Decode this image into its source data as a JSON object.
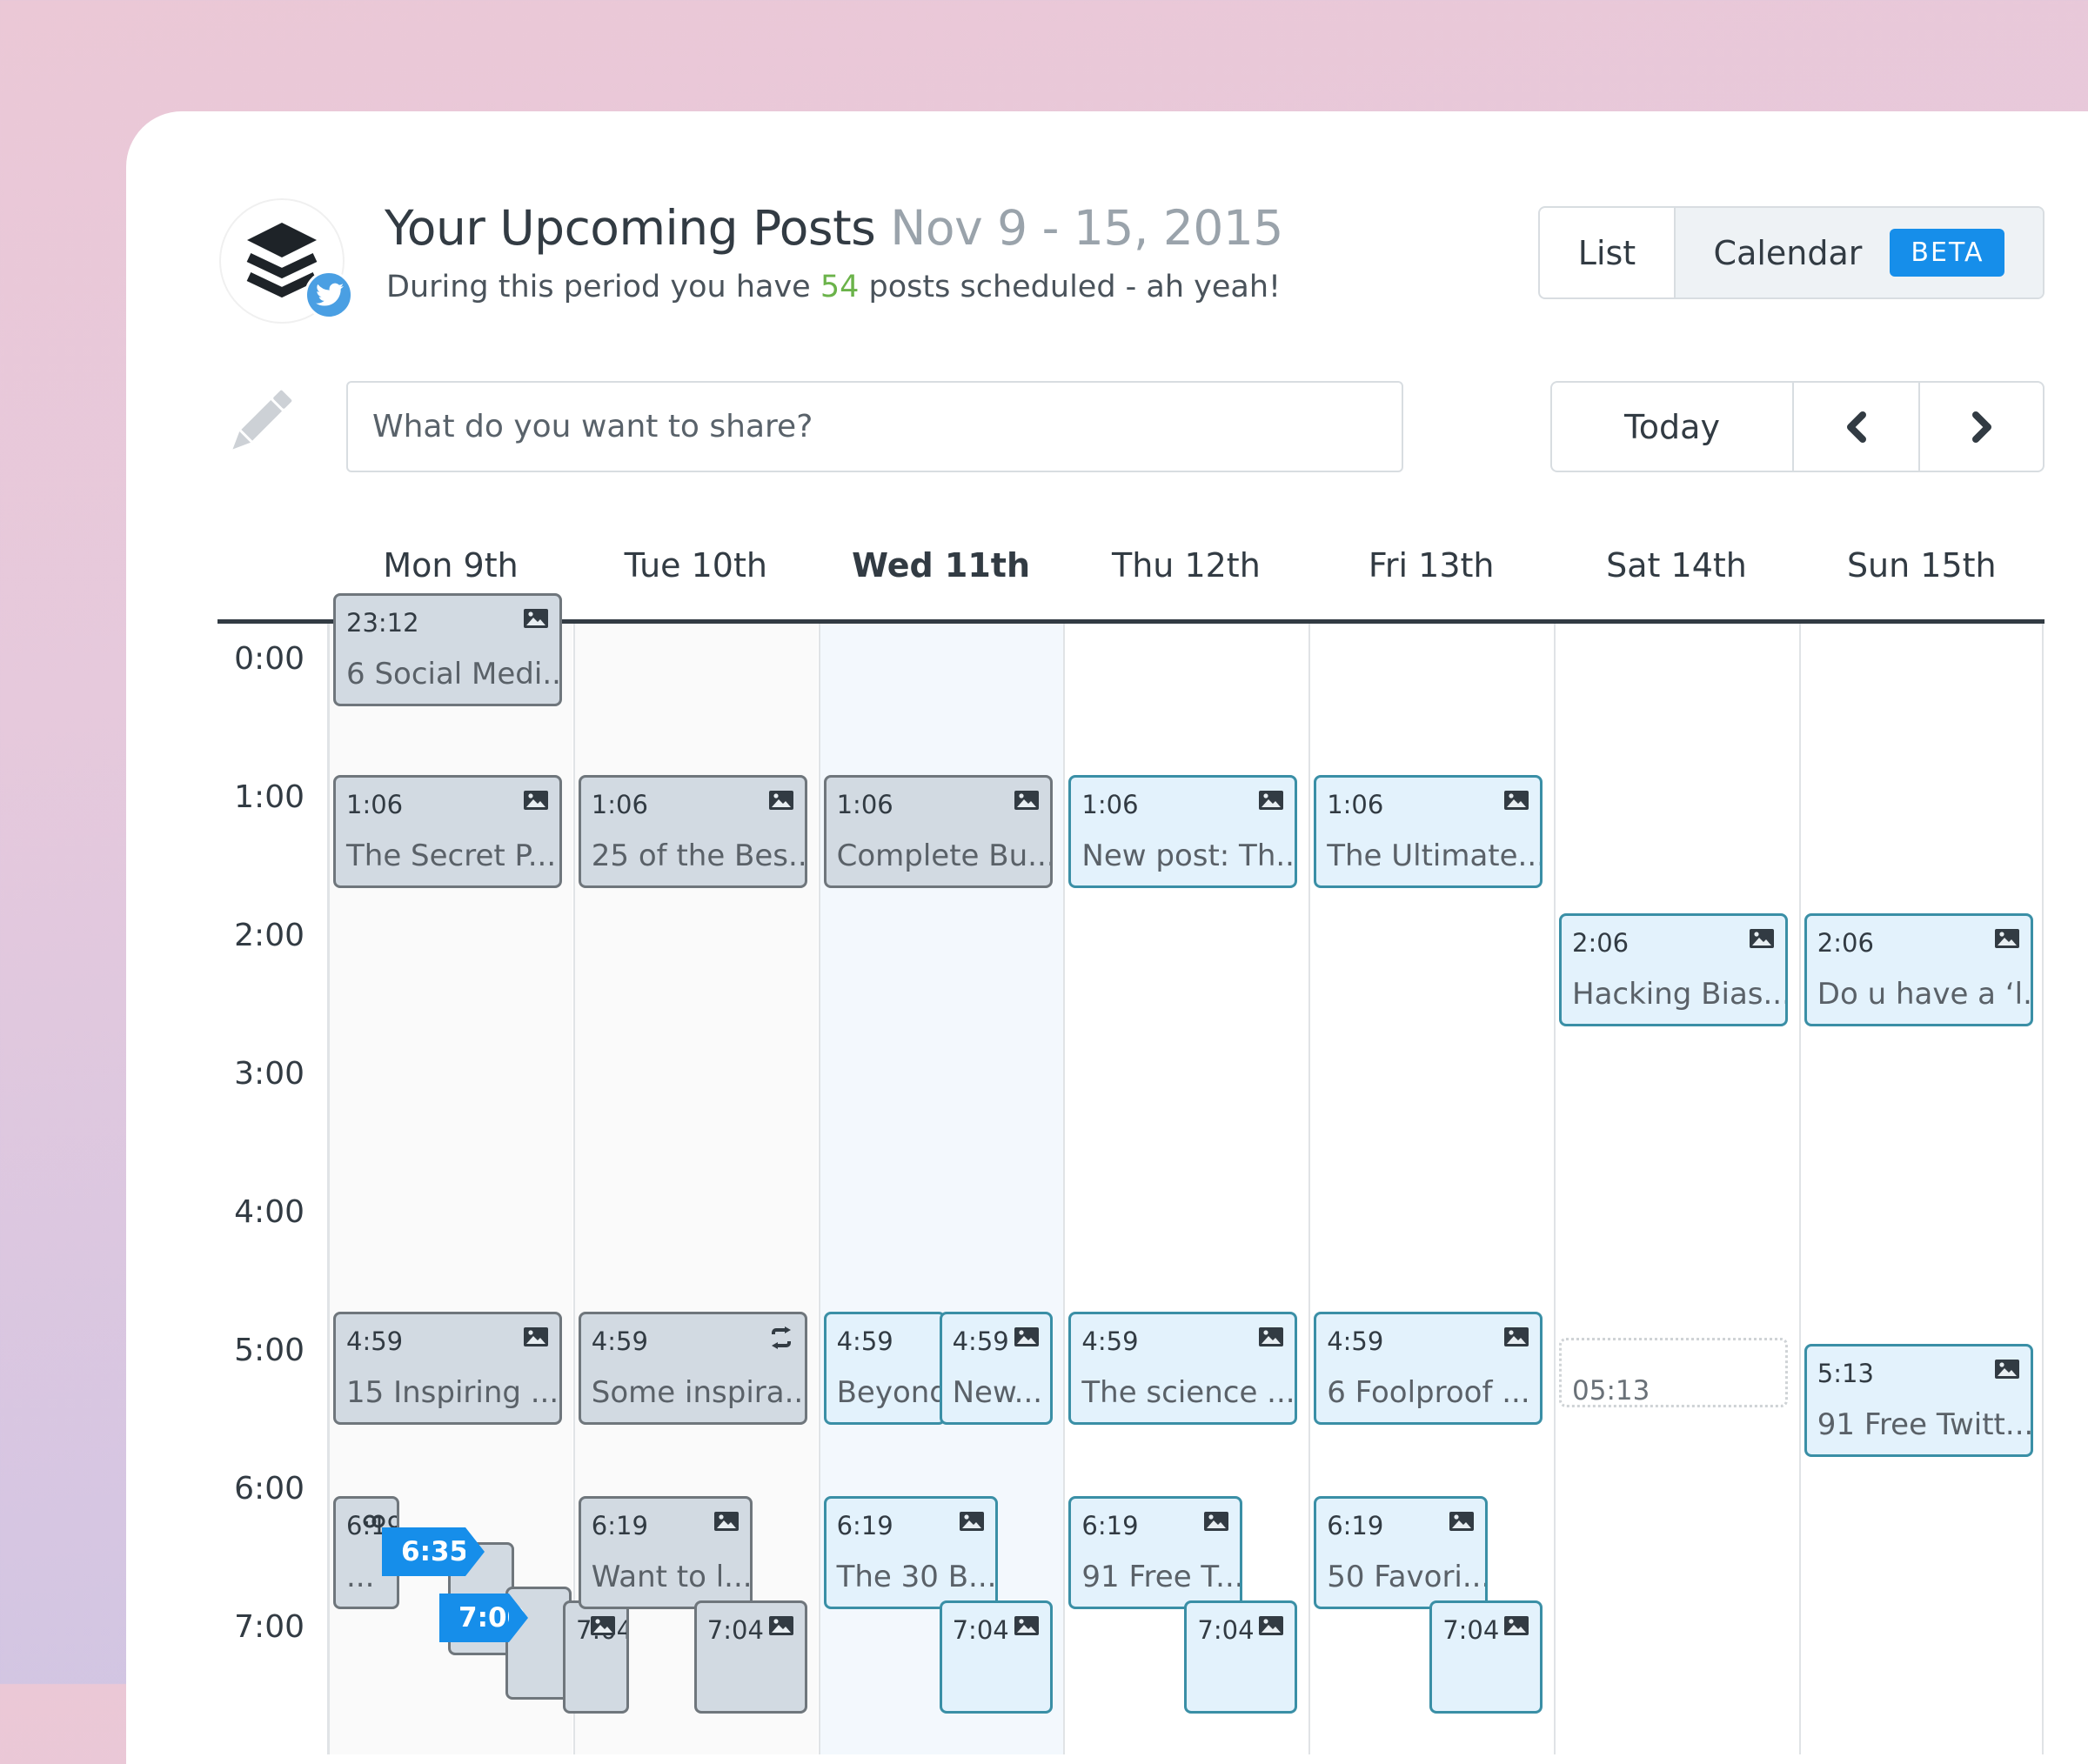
{
  "header": {
    "title": "Your Upcoming Posts",
    "date_range": "Nov 9 - 15, 2015",
    "subtitle_before": "During this period you have",
    "post_count": "54",
    "subtitle_after": "posts scheduled - ah yeah!",
    "logo_icon": "buffer-layers-icon",
    "network_badge_icon": "twitter-icon"
  },
  "view_toggle": {
    "list_label": "List",
    "calendar_label": "Calendar",
    "beta_badge": "BETA",
    "active": "Calendar"
  },
  "composer": {
    "icon": "pencil-icon",
    "placeholder": "What do you want to share?",
    "value": ""
  },
  "navigation": {
    "today_label": "Today",
    "prev_icon": "chevron-left-icon",
    "next_icon": "chevron-right-icon"
  },
  "calendar": {
    "days": [
      {
        "label": "Mon 9th",
        "state": "past"
      },
      {
        "label": "Tue 10th",
        "state": "past"
      },
      {
        "label": "Wed 11th",
        "state": "today"
      },
      {
        "label": "Thu 12th",
        "state": "future"
      },
      {
        "label": "Fri 13th",
        "state": "future"
      },
      {
        "label": "Sat 14th",
        "state": "future"
      },
      {
        "label": "Sun 15th",
        "state": "future"
      }
    ],
    "hours": [
      "0:00",
      "1:00",
      "2:00",
      "3:00",
      "4:00",
      "5:00",
      "6:00",
      "7:00"
    ],
    "events": [
      {
        "day": 0,
        "time": "23:12",
        "title": "6 Social Medi...",
        "icon": "image",
        "state": "past",
        "start": "-0:13"
      },
      {
        "day": 0,
        "time": "1:06",
        "title": "The Secret P...",
        "icon": "image",
        "state": "past"
      },
      {
        "day": 1,
        "time": "1:06",
        "title": "25 of the Bes...",
        "icon": "image",
        "state": "past"
      },
      {
        "day": 2,
        "time": "1:06",
        "title": "Complete Bu...",
        "icon": "image",
        "state": "past"
      },
      {
        "day": 3,
        "time": "1:06",
        "title": "New post: Th...",
        "icon": "image",
        "state": "future"
      },
      {
        "day": 4,
        "time": "1:06",
        "title": "The Ultimate...",
        "icon": "image",
        "state": "future"
      },
      {
        "day": 5,
        "time": "2:06",
        "title": "Hacking Bias...",
        "icon": "image",
        "state": "future"
      },
      {
        "day": 6,
        "time": "2:06",
        "title": "Do u have a ‘l...",
        "icon": "image",
        "state": "future"
      },
      {
        "day": 0,
        "time": "4:59",
        "title": "15 Inspiring ...",
        "icon": "image",
        "state": "past"
      },
      {
        "day": 1,
        "time": "4:59",
        "title": "Some inspira...",
        "icon": "retweet",
        "state": "past"
      },
      {
        "day": 2,
        "time": "4:59",
        "title": "Beyond",
        "icon": "",
        "state": "future",
        "width": "half"
      },
      {
        "day": 2,
        "time": "4:59",
        "title": "New...",
        "icon": "image",
        "state": "future",
        "width": "narrow",
        "offset": 1
      },
      {
        "day": 3,
        "time": "4:59",
        "title": "The science ...",
        "icon": "image",
        "state": "future"
      },
      {
        "day": 4,
        "time": "4:59",
        "title": "6 Foolproof ...",
        "icon": "image",
        "state": "future"
      },
      {
        "day": 5,
        "time": "05:13",
        "title": "",
        "icon": "",
        "state": "placeholder",
        "start": "5:13"
      },
      {
        "day": 6,
        "time": "5:13",
        "title": "91 Free Twitt...",
        "icon": "image",
        "state": "future"
      },
      {
        "day": 0,
        "time": "6:19",
        "title": "...",
        "icon": "link",
        "state": "past",
        "width": "xnarrow"
      },
      {
        "day": 0,
        "time": "",
        "title": "...",
        "icon": "",
        "state": "past",
        "width": "xnarrow",
        "start": "6:39",
        "offset": 2
      },
      {
        "day": 0,
        "time": "",
        "title": "",
        "icon": "",
        "state": "past",
        "width": "xnarrow",
        "start": "6:58",
        "offset": 3
      },
      {
        "day": 0,
        "time": "7:04",
        "title": "",
        "icon": "image",
        "state": "past",
        "width": "xnarrow",
        "start": "7:04",
        "offset": 4
      },
      {
        "day": 1,
        "time": "6:19",
        "title": "Want to l...",
        "icon": "image",
        "state": "past",
        "width": "half"
      },
      {
        "day": 1,
        "time": "7:04",
        "title": "",
        "icon": "image",
        "state": "past",
        "width": "narrow",
        "offset": 1
      },
      {
        "day": 2,
        "time": "6:19",
        "title": "The 30 B...",
        "icon": "image",
        "state": "future",
        "width": "half"
      },
      {
        "day": 2,
        "time": "7:04",
        "title": "",
        "icon": "image",
        "state": "future",
        "width": "narrow",
        "offset": 1
      },
      {
        "day": 3,
        "time": "6:19",
        "title": "91 Free T...",
        "icon": "image",
        "state": "future",
        "width": "half"
      },
      {
        "day": 3,
        "time": "7:04",
        "title": "",
        "icon": "image",
        "state": "future",
        "width": "narrow",
        "offset": 1
      },
      {
        "day": 4,
        "time": "6:19",
        "title": "50 Favori...",
        "icon": "image",
        "state": "future",
        "width": "half"
      },
      {
        "day": 4,
        "time": "7:04",
        "title": "",
        "icon": "image",
        "state": "future",
        "width": "narrow",
        "offset": 1
      }
    ],
    "time_markers": [
      {
        "day": 0,
        "label": "6:35"
      },
      {
        "day": 0,
        "label": "7:00"
      }
    ]
  },
  "colors": {
    "accent": "#168eea",
    "count_green": "#6bb34a",
    "past_card": "#d2dae2",
    "future_card": "#e3f2fc",
    "future_border": "#3a8fa6"
  }
}
